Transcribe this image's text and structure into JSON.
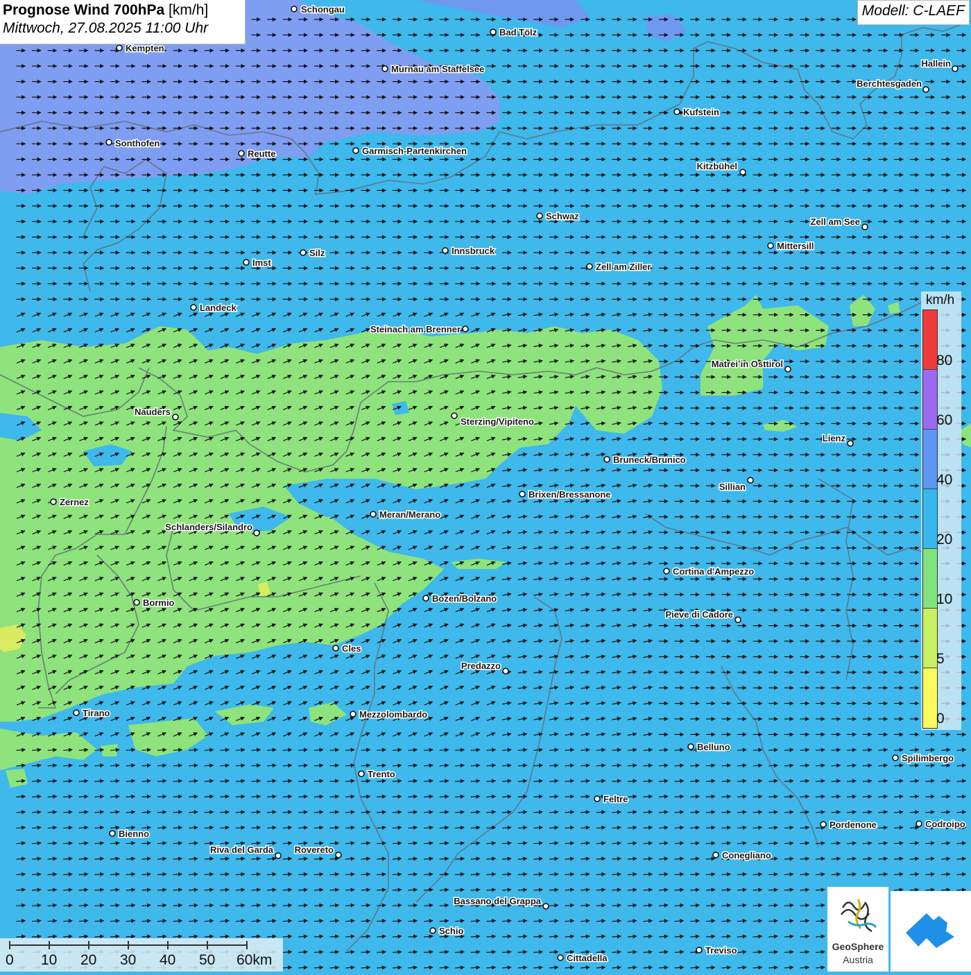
{
  "header": {
    "title_bold": "Prognose Wind 700hPa",
    "title_unit": "[km/h]",
    "datetime": "Mittwoch, 27.08.2025 11:00 Uhr",
    "model": "Modell: C-LAEF"
  },
  "legend": {
    "unit": "km/h",
    "classes": [
      {
        "label": "",
        "color": "#f03a3a"
      },
      {
        "label": "80",
        "color": "#9b6af0"
      },
      {
        "label": "60",
        "color": "#5e96f2"
      },
      {
        "label": "40",
        "color": "#34b8ee"
      },
      {
        "label": "20",
        "color": "#80e27c"
      },
      {
        "label": "10",
        "color": "#c8f060"
      },
      {
        "label": "5",
        "color": "#fafa5a"
      },
      {
        "label": "0",
        "color": ""
      }
    ]
  },
  "wind_field": {
    "dominant_direction": "west-southwest to east",
    "zone_colors": {
      "base": "#3fb8ec",
      "strong": "#7f9ef2",
      "calm": "#8ee37c",
      "very_calm": "#d9ec60"
    }
  },
  "cities": [
    {
      "name": "Schongau"
    },
    {
      "name": "Bad Tölz"
    },
    {
      "name": "Kempten"
    },
    {
      "name": "Murnau am Staffelsee"
    },
    {
      "name": "Hallein"
    },
    {
      "name": "Berchtesgaden"
    },
    {
      "name": "Kufstein"
    },
    {
      "name": "Sonthofen"
    },
    {
      "name": "Reutte"
    },
    {
      "name": "Garmisch-Partenkirchen"
    },
    {
      "name": "Kitzbühel"
    },
    {
      "name": "Schwaz"
    },
    {
      "name": "Zell am See"
    },
    {
      "name": "Mittersill"
    },
    {
      "name": "Innsbruck"
    },
    {
      "name": "Silz"
    },
    {
      "name": "Imst"
    },
    {
      "name": "Zell am Ziller"
    },
    {
      "name": "Landeck"
    },
    {
      "name": "Steinach am Brenner"
    },
    {
      "name": "Matrei in Osttirol"
    },
    {
      "name": "Nauders"
    },
    {
      "name": "Sterzing/Vipiteno"
    },
    {
      "name": "Lienz"
    },
    {
      "name": "Bruneck/Brunico"
    },
    {
      "name": "Sillian"
    },
    {
      "name": "Zernez"
    },
    {
      "name": "Brixen/Bressanone"
    },
    {
      "name": "Meran/Merano"
    },
    {
      "name": "Schlanders/Silandro"
    },
    {
      "name": "Cortina d'Ampezzo"
    },
    {
      "name": "Bozen/Bolzano"
    },
    {
      "name": "Bormio"
    },
    {
      "name": "Pieve di Cadore"
    },
    {
      "name": "Cles"
    },
    {
      "name": "Predazzo"
    },
    {
      "name": "Tirano"
    },
    {
      "name": "Mezzolombardo"
    },
    {
      "name": "Belluno"
    },
    {
      "name": "Spilimbergo"
    },
    {
      "name": "Trento"
    },
    {
      "name": "Feltre"
    },
    {
      "name": "Pordenone"
    },
    {
      "name": "Codroipo"
    },
    {
      "name": "Bienno"
    },
    {
      "name": "Riva del Garda"
    },
    {
      "name": "Rovereto"
    },
    {
      "name": "Conegliano"
    },
    {
      "name": "Bassano del Grappa"
    },
    {
      "name": "Schio"
    },
    {
      "name": "Treviso"
    },
    {
      "name": "Cittadella"
    }
  ],
  "scalebar": {
    "ticks": [
      "0",
      "10",
      "20",
      "30",
      "40",
      "50",
      "60km"
    ]
  },
  "logo": {
    "name": "GeoSphere",
    "sub": "Austria"
  }
}
